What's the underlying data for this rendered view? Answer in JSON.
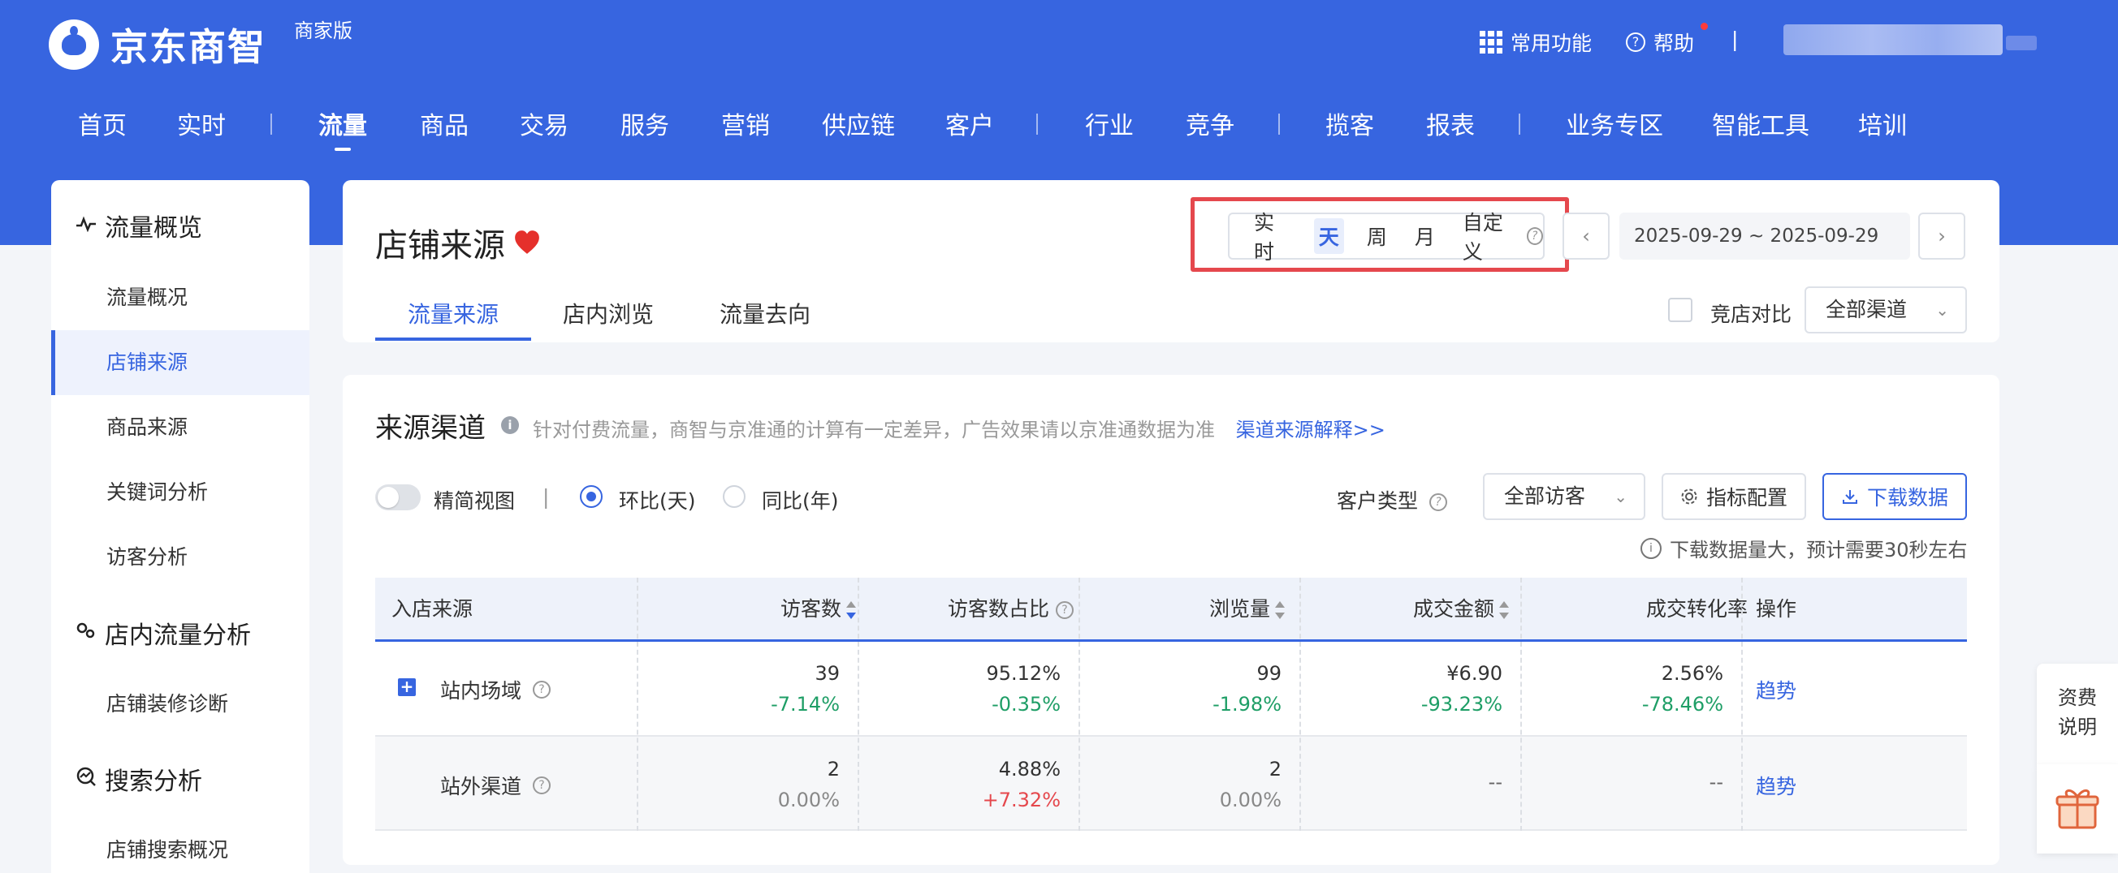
{
  "header": {
    "logo_text": "京东商智",
    "edition": "商家版",
    "common_features": "常用功能",
    "help": "帮助",
    "divider": "|"
  },
  "nav": {
    "items": [
      "首页",
      "实时",
      "流量",
      "商品",
      "交易",
      "服务",
      "营销",
      "供应链",
      "客户",
      "行业",
      "竞争",
      "揽客",
      "报表",
      "业务专区",
      "智能工具",
      "培训"
    ],
    "active": "流量"
  },
  "sidebar": {
    "section1": "流量概览",
    "items1": [
      "流量概况",
      "店铺来源",
      "商品来源",
      "关键词分析",
      "访客分析"
    ],
    "active": "店铺来源",
    "section2": "店内流量分析",
    "items2": [
      "店铺装修诊断"
    ],
    "section3": "搜索分析",
    "items3": [
      "店铺搜索概况"
    ]
  },
  "page": {
    "title": "店铺来源",
    "tabs": [
      "流量来源",
      "店内浏览",
      "流量去向"
    ],
    "active_tab": "流量来源",
    "period": [
      "实时",
      "天",
      "周",
      "月",
      "自定义"
    ],
    "active_period": "天",
    "date_range": "2025-09-29 ~ 2025-09-29",
    "compare_label": "竞店对比",
    "channel_select": "全部渠道"
  },
  "source": {
    "title": "来源渠道",
    "note": "针对付费流量，商智与京准通的计算有一定差异，广告效果请以京准通数据为准",
    "link": "渠道来源解释>>",
    "simple_view": "精简视图",
    "divider": "|",
    "radio_mom": "环比(天)",
    "radio_yoy": "同比(年)",
    "customer_type_label": "客户类型",
    "customer_select": "全部访客",
    "metric_config": "指标配置",
    "download": "下载数据",
    "download_tip": "下载数据量大，预计需要30秒左右"
  },
  "table": {
    "headers": [
      "入店来源",
      "访客数",
      "访客数占比",
      "浏览量",
      "成交金额",
      "成交转化率",
      "操作"
    ],
    "rows": [
      {
        "name": "站内场域",
        "visitors": "39",
        "visitors_chg": "-7.14%",
        "share": "95.12%",
        "share_chg": "-0.35%",
        "pv": "99",
        "pv_chg": "-1.98%",
        "amount": "¥6.90",
        "amount_chg": "-93.23%",
        "cvr": "2.56%",
        "cvr_chg": "-78.46%",
        "action": "趋势"
      },
      {
        "name": "站外渠道",
        "visitors": "2",
        "visitors_chg": "0.00%",
        "share": "4.88%",
        "share_chg": "+7.32%",
        "pv": "2",
        "pv_chg": "0.00%",
        "amount": "--",
        "cvr": "--",
        "action": "趋势"
      }
    ]
  },
  "float": {
    "fee_line1": "资费",
    "fee_line2": "说明"
  },
  "colors": {
    "brand_blue": "#3765e0",
    "positive_red": "#e5484d",
    "negative_green": "#1e9e66",
    "highlight_border": "#e5484d"
  }
}
